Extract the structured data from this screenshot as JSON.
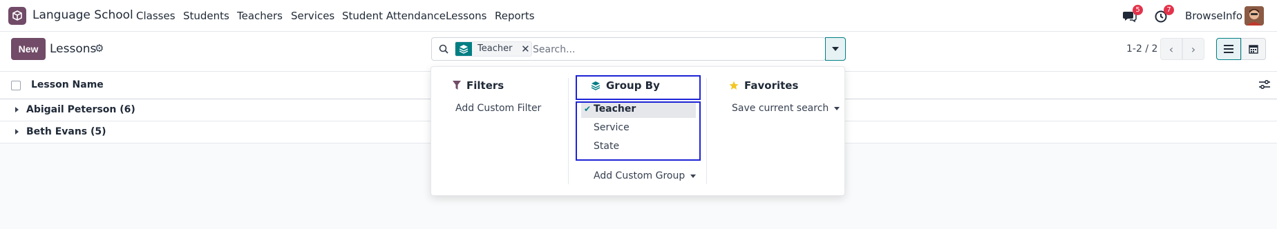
{
  "app": {
    "name": "Language School"
  },
  "nav": {
    "menu": [
      "Classes",
      "Students",
      "Teachers",
      "Services",
      "Student Attendance",
      "Lessons",
      "Reports"
    ],
    "messages_count": "5",
    "activities_count": "7",
    "user_name": "BrowseInfo"
  },
  "control": {
    "new_label": "New",
    "breadcrumb": "Lessons",
    "search": {
      "facet_label": "Teacher",
      "placeholder": "Search..."
    },
    "pager": "1-2 / 2"
  },
  "list": {
    "column_header": "Lesson Name",
    "groups": [
      {
        "label": "Abigail Peterson (6)"
      },
      {
        "label": "Beth Evans (5)"
      }
    ]
  },
  "dropdown": {
    "filters": {
      "title": "Filters",
      "items": [
        "Add Custom Filter"
      ]
    },
    "group_by": {
      "title": "Group By",
      "options": [
        "Teacher",
        "Service",
        "State"
      ],
      "selected": "Teacher",
      "add_custom": "Add Custom Group"
    },
    "favorites": {
      "title": "Favorites",
      "items": [
        "Save current search"
      ]
    }
  },
  "colors": {
    "brand": "#714b67",
    "accent": "#017e84",
    "badge": "#e2334b",
    "highlight": "#1d23d6"
  }
}
